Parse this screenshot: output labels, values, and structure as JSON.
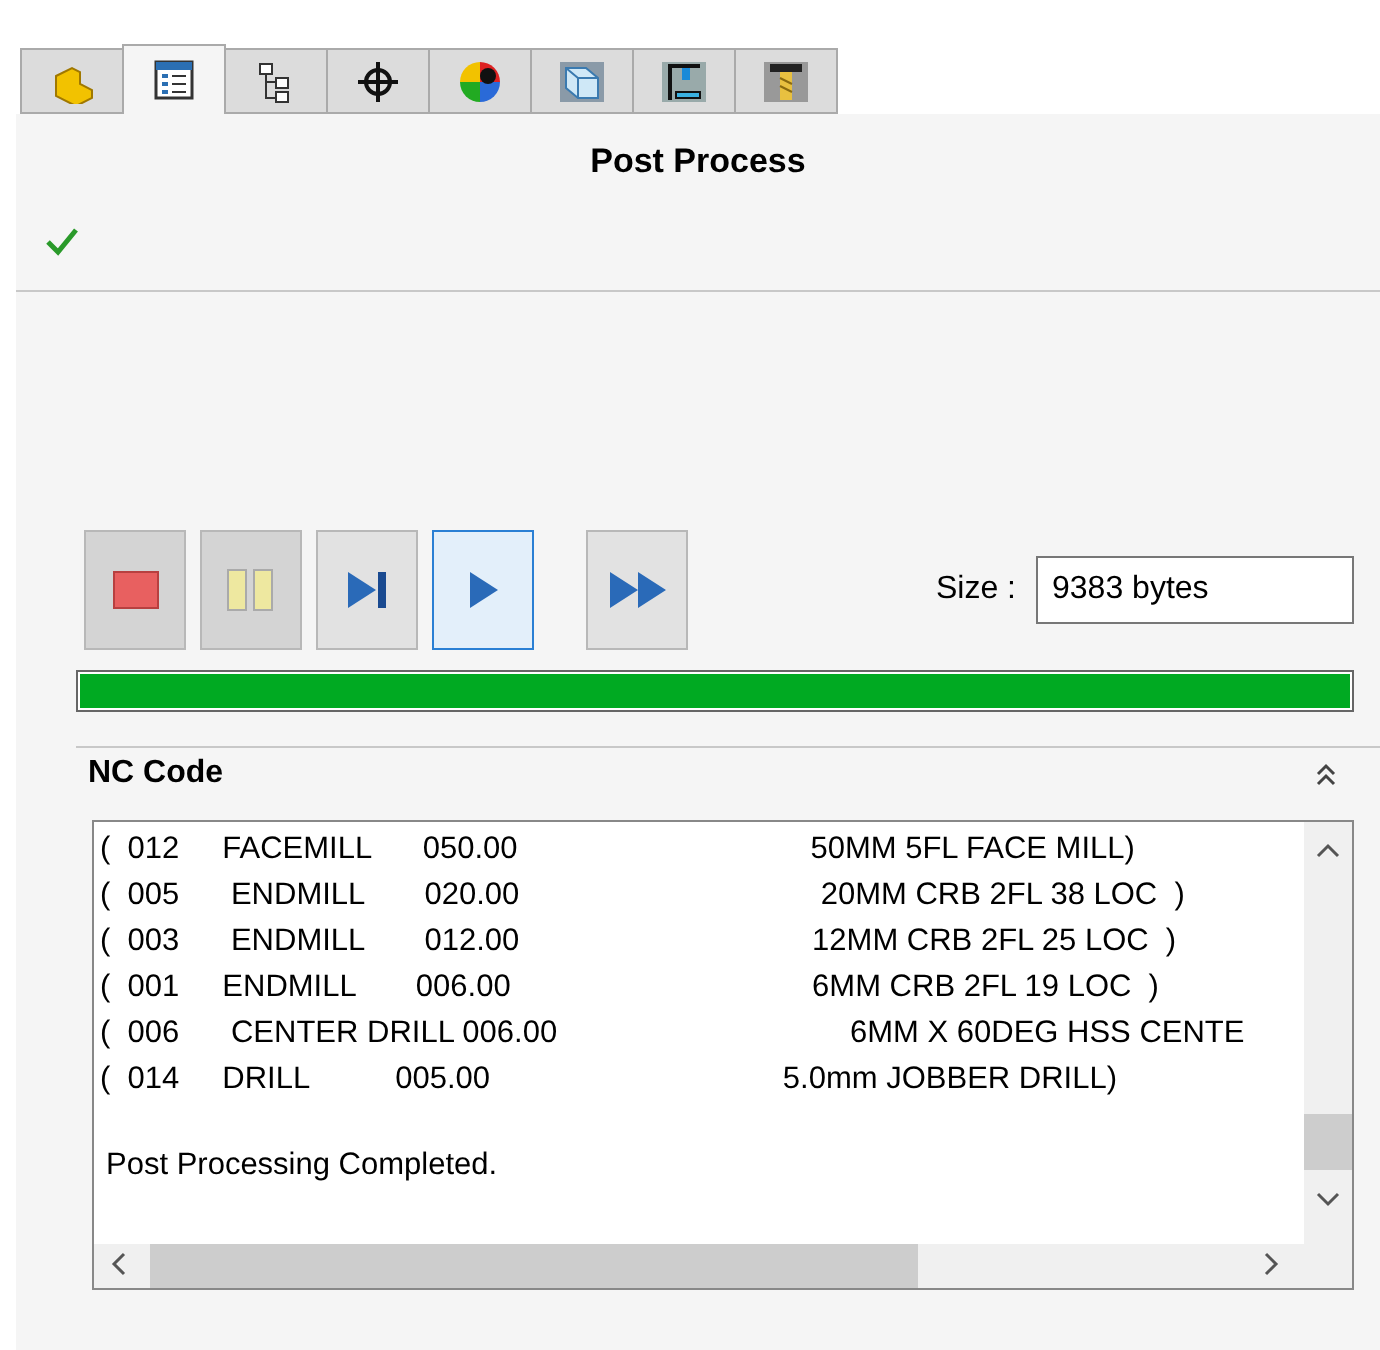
{
  "tabs": [
    {
      "kind": "part",
      "selected": false
    },
    {
      "kind": "list",
      "selected": true
    },
    {
      "kind": "tree",
      "selected": false
    },
    {
      "kind": "crosshair",
      "selected": false
    },
    {
      "kind": "ball",
      "selected": false
    },
    {
      "kind": "cube",
      "selected": false
    },
    {
      "kind": "machine",
      "selected": false
    },
    {
      "kind": "tool",
      "selected": false
    }
  ],
  "panel": {
    "title": "Post Process"
  },
  "controls": [
    {
      "kind": "stop",
      "disabled": true,
      "selected": false
    },
    {
      "kind": "pause",
      "disabled": true,
      "selected": false
    },
    {
      "kind": "step",
      "disabled": false,
      "selected": false
    },
    {
      "kind": "play",
      "disabled": false,
      "selected": true
    },
    {
      "kind": "fast_forward",
      "disabled": false,
      "selected": false
    }
  ],
  "size": {
    "label": "Size :",
    "value": "9383 bytes"
  },
  "progress": {
    "level": 1
  },
  "nc_code": {
    "title": "NC Code",
    "expanded": true,
    "lines": [
      "(  012     FACEMILL      050.00                                  50MM 5FL FACE MILL)",
      "(  005      ENDMILL       020.00                                   20MM CRB 2FL 38 LOC  )",
      "(  003      ENDMILL       012.00                                  12MM CRB 2FL 25 LOC  )",
      "(  001     ENDMILL       006.00                                   6MM CRB 2FL 19 LOC  )",
      "(  006      CENTER DRILL 006.00                                  6MM X 60DEG HSS CENTE",
      "(  014     DRILL          005.00                                  5.0mm JOBBER DRILL)"
    ],
    "message": "Post Processing Completed."
  }
}
